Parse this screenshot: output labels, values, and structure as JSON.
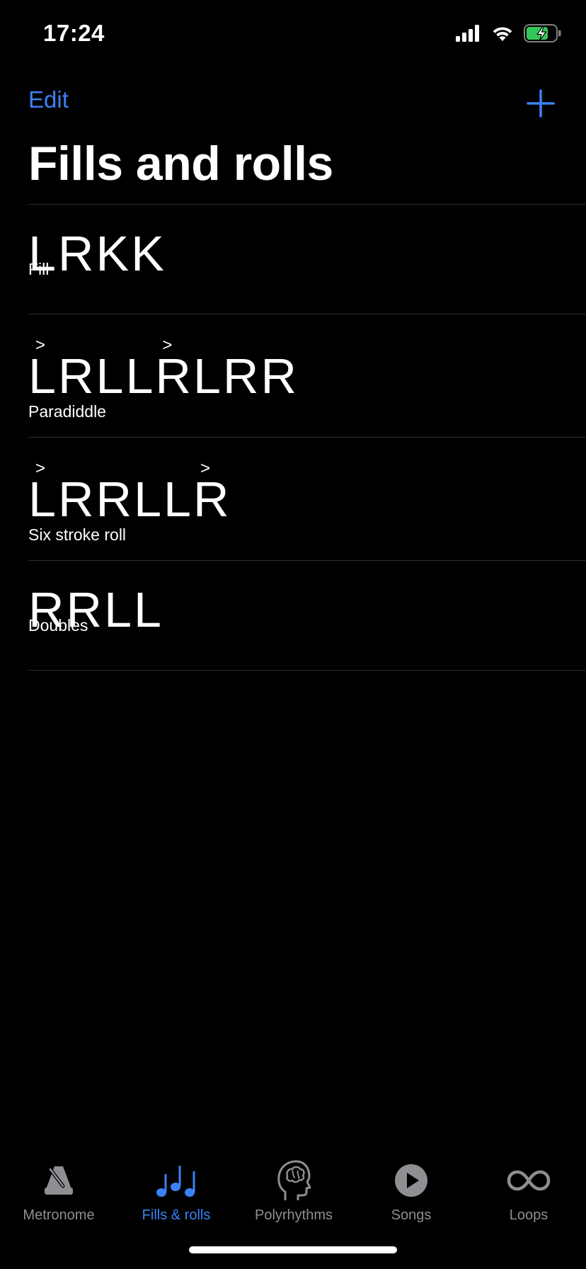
{
  "status_bar": {
    "time": "17:24",
    "icons": [
      "cellular-signal-icon",
      "wifi-icon",
      "battery-charging-icon"
    ]
  },
  "nav": {
    "edit_label": "Edit",
    "add_icon": "plus-icon"
  },
  "page": {
    "title": "Fills and rolls"
  },
  "items": [
    {
      "pattern": "LRKK",
      "name": "Fill",
      "accent": ">",
      "accented_positions": []
    },
    {
      "pattern": "LRLLRLRR",
      "name": "Paradiddle",
      "accent": ">",
      "accented_positions": [
        1,
        5
      ]
    },
    {
      "pattern": "LRRLLR",
      "name": "Six stroke roll",
      "accent": ">",
      "accented_positions": [
        1,
        6
      ]
    },
    {
      "pattern": "RRLL",
      "name": "Doubles",
      "accent": ">",
      "accented_positions": []
    }
  ],
  "tabs": [
    {
      "label": "Metronome",
      "icon": "metronome-icon",
      "active": false
    },
    {
      "label": "Fills & rolls",
      "icon": "music-notes-icon",
      "active": true
    },
    {
      "label": "Polyrhythms",
      "icon": "brain-head-icon",
      "active": false
    },
    {
      "label": "Songs",
      "icon": "play-circle-icon",
      "active": false
    },
    {
      "label": "Loops",
      "icon": "infinity-icon",
      "active": false
    }
  ],
  "colors": {
    "background": "#000000",
    "accent": "#3B82F6",
    "inactive": "#8E8E93",
    "separator": "#2C2C2E",
    "battery": "#34C759"
  }
}
